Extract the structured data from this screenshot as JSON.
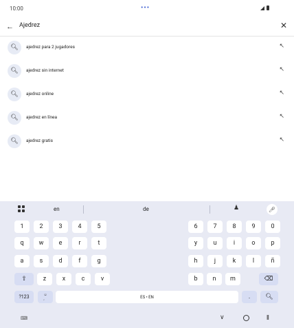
{
  "status": {
    "time": "10:00",
    "dots": "•••"
  },
  "search": {
    "query": "Ajedrez",
    "back_icon": "←",
    "clear_icon": "✕"
  },
  "suggestions": [
    {
      "text": "ajedrez para 2 jugadores"
    },
    {
      "text": "ajedrez sin internet"
    },
    {
      "text": "ajedrez online"
    },
    {
      "text": "ajedrez en línea"
    },
    {
      "text": "ajedrez gratis"
    }
  ],
  "keyboard": {
    "suggestions": [
      "en",
      "de"
    ],
    "row_numbers_left": [
      "1",
      "2",
      "3",
      "4",
      "5"
    ],
    "row_numbers_right": [
      "6",
      "7",
      "8",
      "9",
      "0"
    ],
    "row1_left": [
      "q",
      "w",
      "e",
      "r",
      "t"
    ],
    "row1_right": [
      "y",
      "u",
      "i",
      "o",
      "p"
    ],
    "row2_left": [
      "a",
      "s",
      "d",
      "f",
      "g"
    ],
    "row2_right": [
      "h",
      "j",
      "k",
      "l",
      "ñ"
    ],
    "row3_left": [
      "z",
      "x",
      "c",
      "v"
    ],
    "row3_right": [
      "b",
      "n",
      "m"
    ],
    "symbols_label": "?123",
    "space_label": "ES • EN",
    "period": "."
  }
}
